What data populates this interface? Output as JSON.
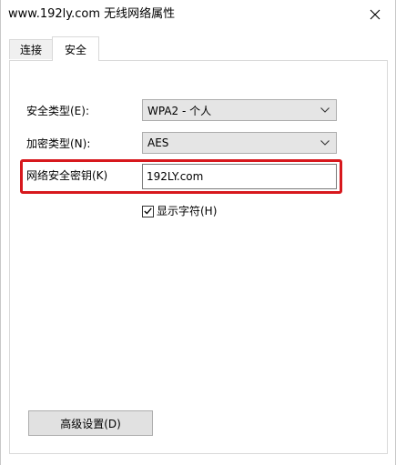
{
  "window": {
    "title": "www.192ly.com 无线网络属性"
  },
  "tabs": [
    {
      "label": "连接",
      "selected": false
    },
    {
      "label": "安全",
      "selected": true
    }
  ],
  "form": {
    "security_type_label": "安全类型(E):",
    "security_type_value": "WPA2 - 个人",
    "encryption_type_label": "加密类型(N):",
    "encryption_type_value": "AES",
    "network_key_label": "网络安全密钥(K)",
    "network_key_value": "192LY.com",
    "show_chars_label": "显示字符(H)",
    "show_chars_checked": true
  },
  "buttons": {
    "advanced_label": "高级设置(D)"
  },
  "colors": {
    "highlight": "#d7181d",
    "tab_inactive": "#f0f0f0",
    "select_bg": "#e5e5e5",
    "button_bg": "#e1e1e1"
  },
  "icons": {
    "close": "close-icon",
    "dropdown": "chevron-down-icon",
    "checkbox": "checkmark-icon"
  }
}
